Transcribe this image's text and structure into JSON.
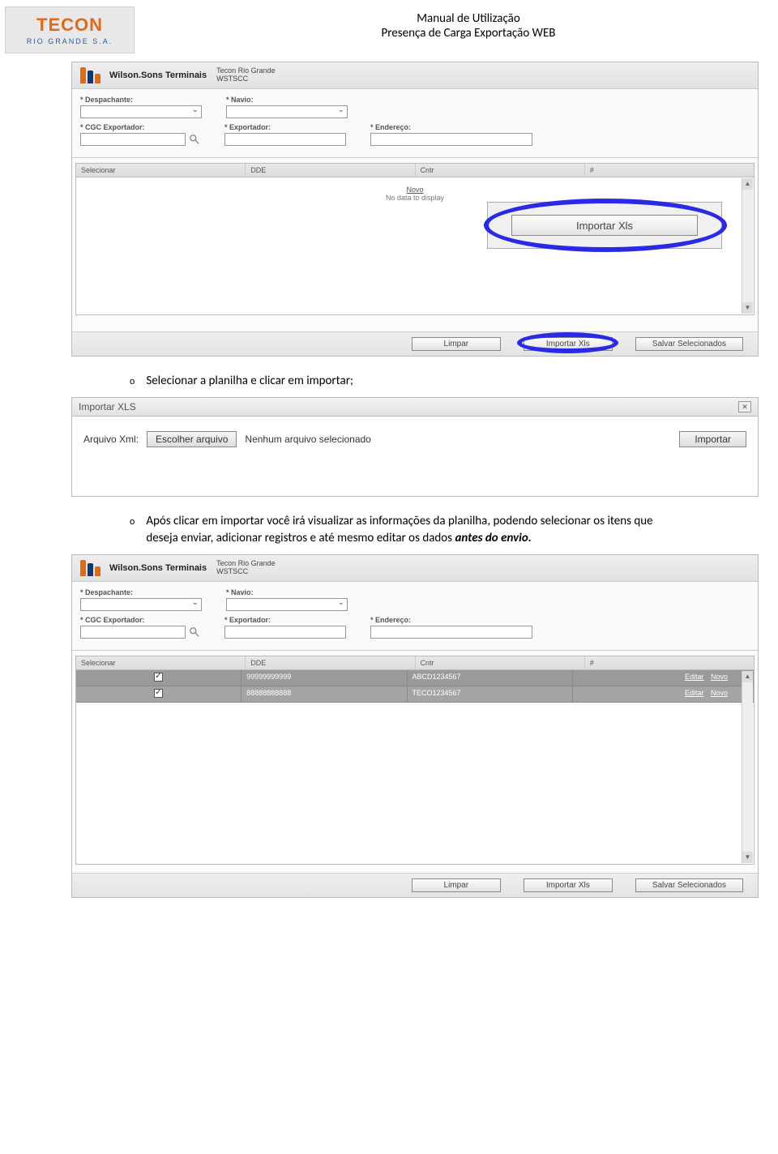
{
  "header": {
    "logo_main": "TECON",
    "logo_sub": "RIO GRANDE S.A.",
    "title1": "Manual de Utilização",
    "title2": "Presença de Carga Exportação WEB"
  },
  "ws": {
    "brand": "Wilson.Sons Terminais",
    "sub1": "Tecon Rio Grande",
    "sub2": "WSTSCC"
  },
  "form": {
    "despachante": "* Despachante:",
    "navio": "* Navio:",
    "cgc": "* CGC Exportador:",
    "exportador": "* Exportador:",
    "endereco": "* Endereço:"
  },
  "grid": {
    "h1": "Selecionar",
    "h2": "DDE",
    "h3": "Cntr",
    "h4": "#",
    "novo": "Novo",
    "nodata": "No data to display"
  },
  "callout_btn": "Importar Xls",
  "footer": {
    "limpar": "Limpar",
    "importar": "Importar Xls",
    "salvar": "Salvar Selecionados"
  },
  "bullet1": "Selecionar a planilha e clicar em importar;",
  "dialog": {
    "title": "Importar XLS",
    "field": "Arquivo Xml:",
    "choose": "Escolher arquivo",
    "nofile": "Nenhum arquivo selecionado",
    "import": "Importar"
  },
  "bullet2a": "Após clicar em importar você irá visualizar as informações da planilha, podendo selecionar os itens que deseja enviar, adicionar registros e até mesmo  editar os dados ",
  "bullet2b": "antes do envio.",
  "rows": [
    {
      "dde": "99999999999",
      "cntr": "ABCD1234567",
      "link1": "Editar",
      "link2": "Novo"
    },
    {
      "dde": "88888888888",
      "cntr": "TECO1234567",
      "link1": "Editar",
      "link2": "Novo"
    }
  ]
}
